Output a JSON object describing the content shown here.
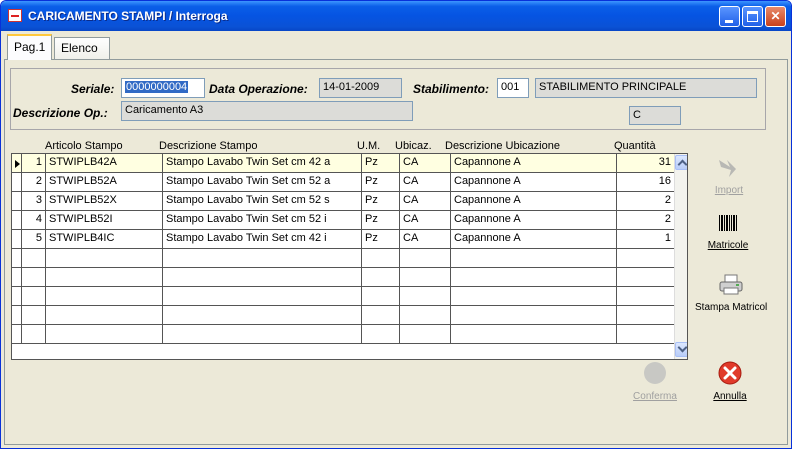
{
  "window": {
    "title": "CARICAMENTO STAMPI / Interroga",
    "min_label": "_",
    "close_label": "✕"
  },
  "tabs": [
    {
      "label": "Pag.1",
      "active": true
    },
    {
      "label": "Elenco",
      "active": false
    }
  ],
  "form": {
    "seriale_label": "Seriale:",
    "seriale_value": "0000000004",
    "data_label": "Data Operazione:",
    "data_value": "14-01-2009",
    "stabilimento_label": "Stabilimento:",
    "stabilimento_code": "001",
    "stabilimento_name": "STABILIMENTO PRINCIPALE",
    "descrizione_label": "Descrizione Op.:",
    "descrizione_value": "Caricamento A3",
    "extra_value": "C"
  },
  "grid": {
    "columns": [
      "Articolo Stampo",
      "Descrizione Stampo",
      "U.M.",
      "Ubicaz.",
      "Descrizione Ubicazione",
      "Quantità"
    ],
    "rows": [
      {
        "n": "1",
        "articolo": "STWIPLB42A",
        "descrizione": "Stampo Lavabo Twin Set cm 42 a",
        "um": "Pz",
        "ubicaz": "CA",
        "desc_ubic": "Capannone A",
        "qta": "31"
      },
      {
        "n": "2",
        "articolo": "STWIPLB52A",
        "descrizione": "Stampo Lavabo Twin Set cm 52 a",
        "um": "Pz",
        "ubicaz": "CA",
        "desc_ubic": "Capannone A",
        "qta": "16"
      },
      {
        "n": "3",
        "articolo": "STWIPLB52X",
        "descrizione": "Stampo Lavabo Twin Set cm 52 s",
        "um": "Pz",
        "ubicaz": "CA",
        "desc_ubic": "Capannone A",
        "qta": "2"
      },
      {
        "n": "4",
        "articolo": "STWIPLB52I",
        "descrizione": "Stampo Lavabo Twin Set cm 52 i",
        "um": "Pz",
        "ubicaz": "CA",
        "desc_ubic": "Capannone A",
        "qta": "2"
      },
      {
        "n": "5",
        "articolo": "STWIPLB4IC",
        "descrizione": "Stampo Lavabo Twin Set cm 42 i",
        "um": "Pz",
        "ubicaz": "CA",
        "desc_ubic": "Capannone A",
        "qta": "1"
      }
    ]
  },
  "actions": {
    "import_label": "Import",
    "matricole_label": "Matricole",
    "stampa_label": "Stampa Matricole",
    "conferma_label": "Conferma",
    "annulla_label": "Annulla"
  },
  "colors": {
    "titlebar": "#0654e2",
    "selection": "#316ac5",
    "selected_row": "#ffffe1",
    "annulla_red": "#e03a2a"
  }
}
